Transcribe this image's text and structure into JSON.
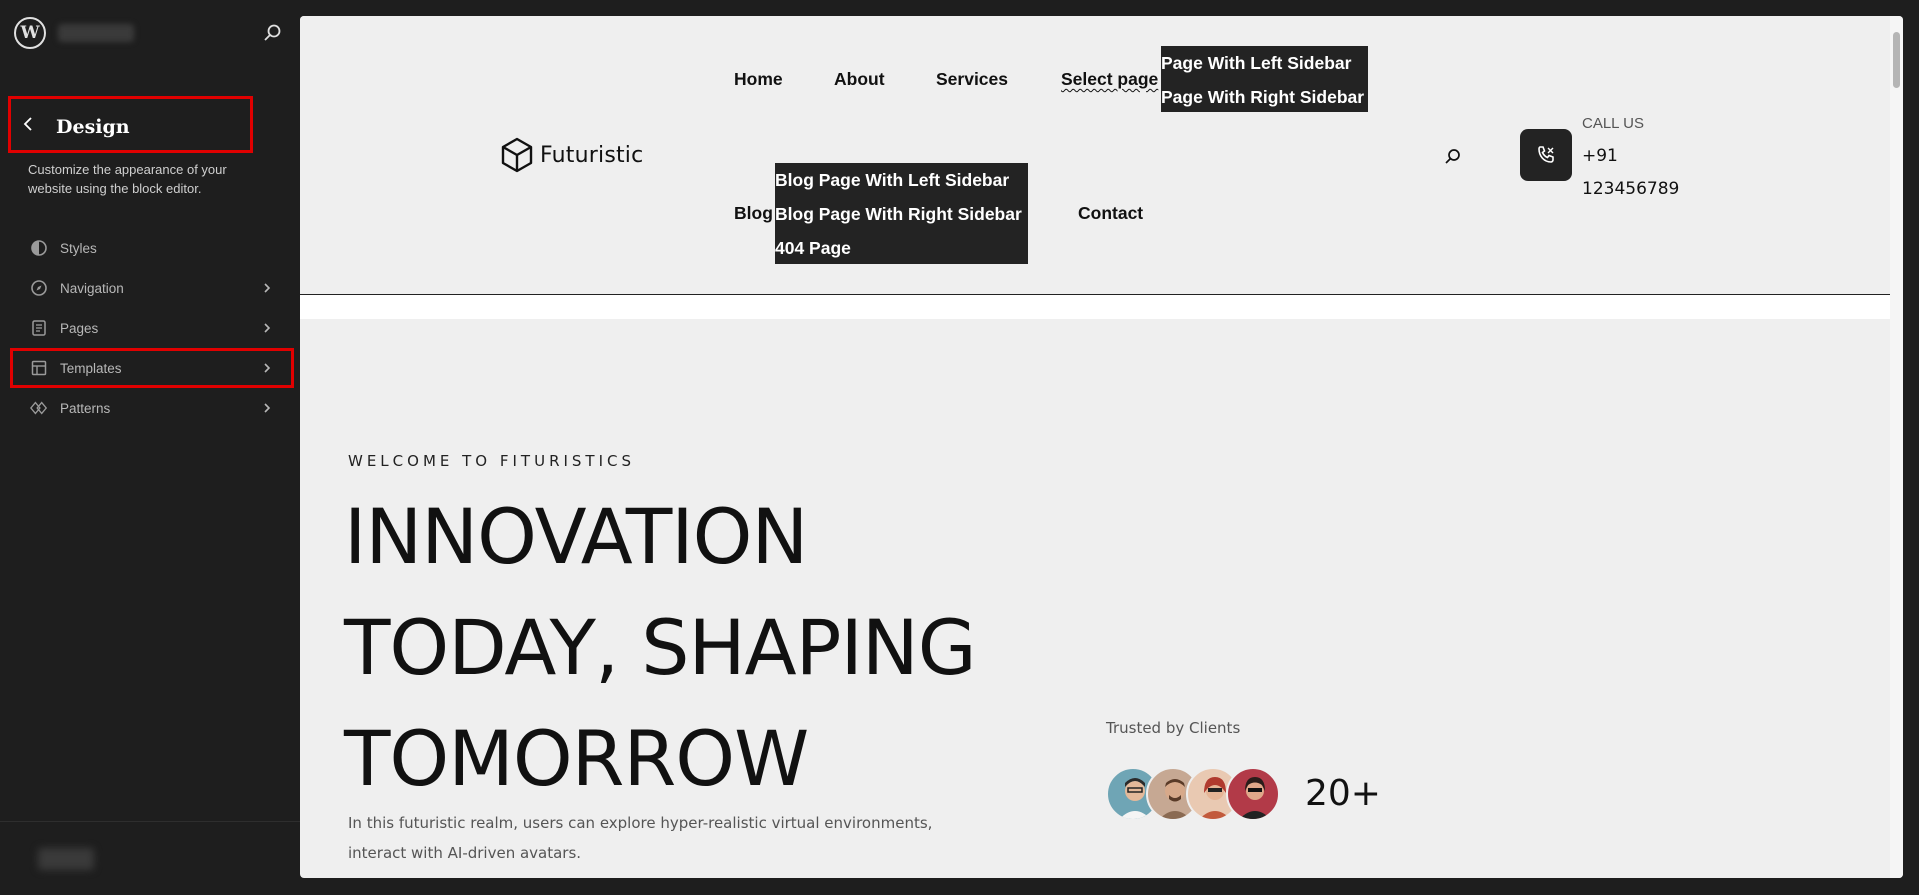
{
  "sidebar": {
    "back_label": "‹",
    "title": "Design",
    "description": "Customize the appearance of your website using the block editor.",
    "items": [
      {
        "label": "Styles",
        "icon": "half-circle-icon",
        "has_chevron": false
      },
      {
        "label": "Navigation",
        "icon": "compass-icon",
        "has_chevron": true
      },
      {
        "label": "Pages",
        "icon": "page-icon",
        "has_chevron": true
      },
      {
        "label": "Templates",
        "icon": "layout-icon",
        "has_chevron": true
      },
      {
        "label": "Patterns",
        "icon": "diamond-icon",
        "has_chevron": true
      }
    ],
    "highlight_color": "#e00000"
  },
  "site": {
    "logo_text": "Futuristic",
    "nav": {
      "home": "Home",
      "about": "About",
      "services": "Services",
      "select_page": "Select page",
      "select_page_submenu": [
        "Page With Left Sidebar",
        "Page With Right Sidebar"
      ],
      "blog": "Blog",
      "blog_submenu": [
        "Blog Page With Left Sidebar",
        "Blog Page With Right Sidebar",
        "404 Page"
      ],
      "contact": "Contact"
    },
    "call": {
      "label": "CALL US",
      "number_line1": "+91",
      "number_line2": "123456789"
    },
    "hero": {
      "eyebrow": "WELCOME TO FITURISTICS",
      "title_line1": "INNOVATION",
      "title_line2": "TODAY, SHAPING",
      "title_line3": "TOMORROW",
      "description": "In this futuristic realm, users can explore hyper-realistic virtual environments, interact with AI-driven avatars."
    },
    "trusted": {
      "label": "Trusted by Clients",
      "count": "20+"
    }
  },
  "colors": {
    "sidebar_bg": "#1e1e1e",
    "canvas_bg": "#efefef",
    "dropdown_bg": "#232323",
    "highlight": "#e00000"
  }
}
